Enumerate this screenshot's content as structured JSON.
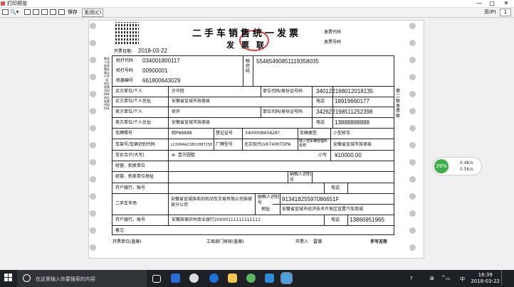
{
  "window": {
    "title": "打印预览",
    "min": "—",
    "max": "□",
    "close": "✕"
  },
  "toolbar": {
    "print_label": "保存",
    "close_label": "关闭(C)",
    "page_label": "页(P)",
    "page_value": "1"
  },
  "invoice": {
    "title": "二手车销售统一发票",
    "subtitle": "发票联",
    "invoice_code_label": "发票代码",
    "invoice_no_label": "发票号码",
    "issue_date_label": "开票日期:",
    "issue_date": "2018-03-22",
    "machine_code_label": "机打代码",
    "machine_code": "034001800117",
    "machine_no_label": "机打号码",
    "machine_no": "00900001",
    "device_no_label": "机器编号",
    "device_no": "661800643029",
    "tax_code_label": "税控码",
    "tax_code": "55465490851119358035",
    "buyer_label": "买方单位/个人",
    "buyer": "许华胜",
    "buyer_id_label": "单位代码/身份证号码",
    "buyer_id": "340122198012018135",
    "buyer_addr_label": "买方单位/个人住址",
    "buyer_addr": "安徽省宣城市旌德县",
    "buyer_phone_label": "电话",
    "buyer_phone": "18919660177",
    "seller_label": "卖方单位/个人",
    "seller": "徐环",
    "seller_id_label": "单位代码/身份证号码",
    "seller_id": "342622198511252398",
    "seller_addr_label": "卖方单位/个人住址",
    "seller_addr": "安徽省宣城市旌德县",
    "seller_phone_label": "电话",
    "seller_phone": "13888888888",
    "plate_label": "车牌照号",
    "plate": "皖P88888",
    "reg_no_label": "登记证号",
    "reg_no": "340000865828?",
    "vehicle_type_label": "车辆类型",
    "vehicle_type": "小型轿车",
    "vin_label": "车架号/车辆识别代码",
    "vin": "LC0994A21B01H87256",
    "model_label": "厂牌型号",
    "model": "北京现代LV67400TDPA",
    "transfer_office_label": "转入地车辆管理所名称",
    "transfer_office": "安徽省宣城市旌德县",
    "total_label": "车价合计(大写)",
    "total_upper": "壹万圆整",
    "total_small_label": "小写",
    "total_small": "¥10000.00",
    "auction_label": "经营、拍卖单位",
    "auction_addr_label": "经营、拍卖单位地址",
    "taxpayer_id_label1": "纳税人识别号",
    "bank_label1": "开户银行、账号",
    "phone_label1": "电话",
    "market_label": "二手车市场",
    "market_name": "安徽省宣城旌商旧机动车交易有限公司旌德县分公司",
    "market_taxid_label": "纳税人识别号",
    "market_taxid": "91341825597086651F",
    "market_addr_label": "地址",
    "market_addr": "安徽省宣城市经济技术开发区宣置汽车商城",
    "bank_label2": "开户银行、账号",
    "bank_value": "安徽旌德农村商业银行20000111111111111",
    "phone_label2": "电话",
    "phone_value": "13866951965",
    "remark_label": "备注:",
    "seller_sign": "开票单位(盖章)",
    "tax_office": "工商部门审核(盖章)",
    "issuer_label": "开票人",
    "issuer": "雷珊",
    "note": "手写无效",
    "side_right": "第二联发票联",
    "side_left": "购车人凭此发票办理过户手续 机打发票号码 00900001 机打发票代码 034001800117"
  },
  "network": {
    "percent": "39%",
    "up": "0.4K/s",
    "down": "0.5K/s"
  },
  "taskbar": {
    "search_placeholder": "在这里输入你要搜索的内容",
    "time": "16:39",
    "date": "2018-03-22",
    "lang": "中"
  }
}
